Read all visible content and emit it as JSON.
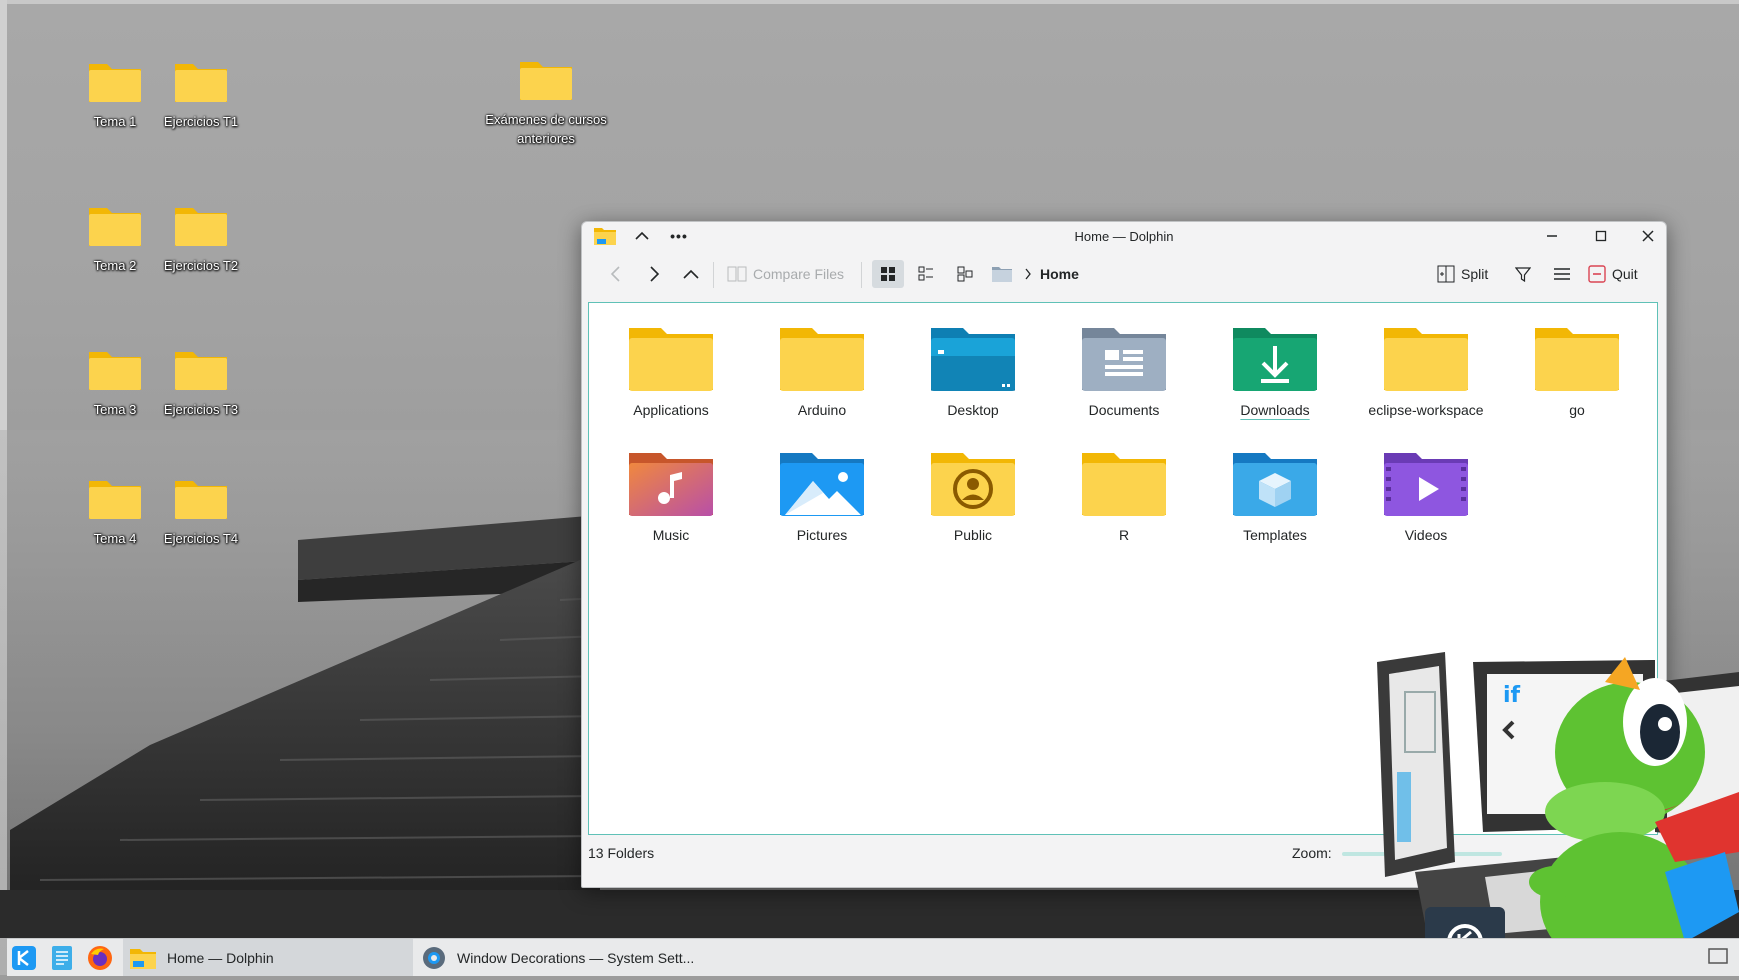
{
  "desktop": {
    "icons": [
      {
        "label": "Tema 1"
      },
      {
        "label": "Ejercicios T1"
      },
      {
        "label": "Exámenes de cursos anteriores"
      },
      {
        "label": "Tema 2"
      },
      {
        "label": "Ejercicios T2"
      },
      {
        "label": "Tema 3"
      },
      {
        "label": "Ejercicios T3"
      },
      {
        "label": "Tema 4"
      },
      {
        "label": "Ejercicios T4"
      }
    ]
  },
  "window": {
    "title": "Home — Dolphin",
    "toolbar": {
      "compare_files": "Compare Files",
      "breadcrumb_current": "Home",
      "split": "Split",
      "quit": "Quit"
    },
    "items": [
      {
        "label": "Applications",
        "icon": "folder-icon"
      },
      {
        "label": "Arduino",
        "icon": "folder-icon"
      },
      {
        "label": "Desktop",
        "icon": "folder-desktop-icon"
      },
      {
        "label": "Documents",
        "icon": "folder-documents-icon"
      },
      {
        "label": "Downloads",
        "icon": "folder-downloads-icon"
      },
      {
        "label": "eclipse-workspace",
        "icon": "folder-icon"
      },
      {
        "label": "go",
        "icon": "folder-icon"
      },
      {
        "label": "Music",
        "icon": "folder-music-icon"
      },
      {
        "label": "Pictures",
        "icon": "folder-pictures-icon"
      },
      {
        "label": "Public",
        "icon": "folder-public-icon"
      },
      {
        "label": "R",
        "icon": "folder-icon"
      },
      {
        "label": "Templates",
        "icon": "folder-templates-icon"
      },
      {
        "label": "Videos",
        "icon": "folder-videos-icon"
      }
    ],
    "status": {
      "count": "13 Folders",
      "zoom_label": "Zoom:"
    }
  },
  "taskbar": {
    "tasks": [
      {
        "label": "Home — Dolphin",
        "active": true
      },
      {
        "label": "Window Decorations — System Sett...",
        "active": false
      }
    ]
  },
  "colors": {
    "folder_yellow": "#fcd34d",
    "accent_teal": "#5fc1b7",
    "quit_red": "#da4453"
  }
}
